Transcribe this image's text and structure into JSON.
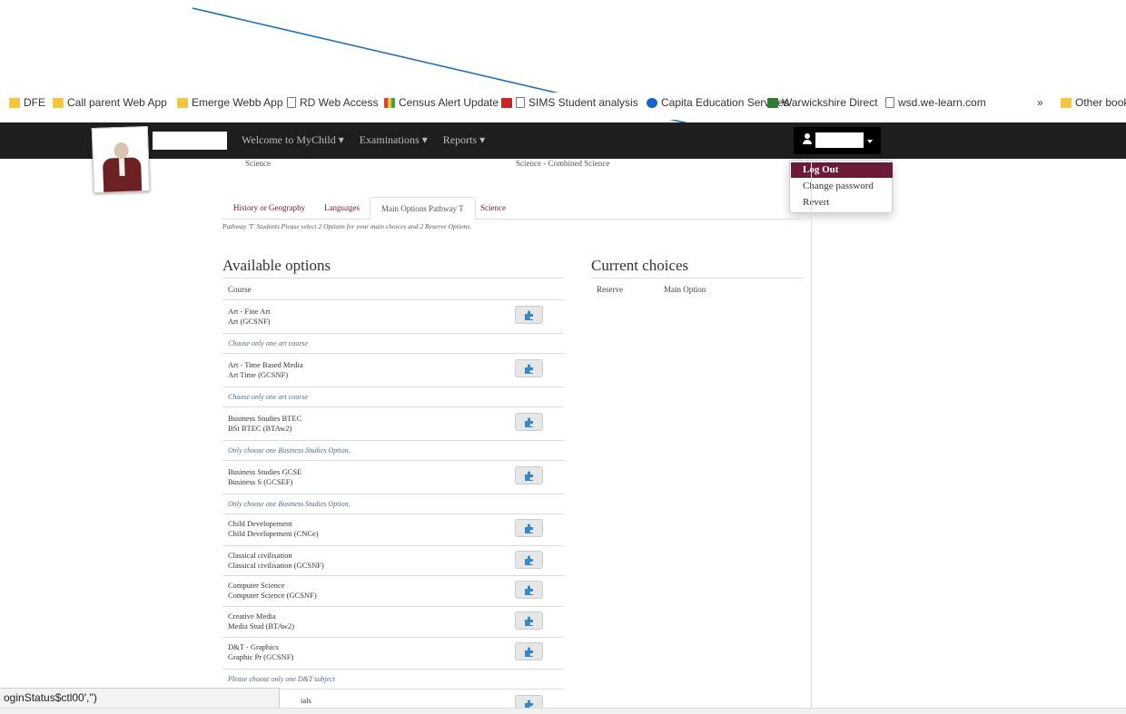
{
  "bookmarks": [
    {
      "label": "DFE",
      "icon": "folder-icon"
    },
    {
      "label": "Call parent Web App",
      "icon": "folder-icon"
    },
    {
      "label": "Emerge Webb App",
      "icon": "folder-icon"
    },
    {
      "label": "RD Web Access",
      "icon": "page-icon"
    },
    {
      "label": "Census Alert Update",
      "icon": "green-icon"
    },
    {
      "label": "SIMS Student analysis",
      "icon": "page-icon"
    },
    {
      "label": "Capita Education Services",
      "icon": "blue-icon"
    },
    {
      "label": "Warwickshire Direct",
      "icon": "page-icon"
    },
    {
      "label": "wsd.we-learn.com",
      "icon": "page-icon"
    },
    {
      "label": "»",
      "icon": ""
    },
    {
      "label": "Other bookmarks",
      "icon": "folder-icon"
    }
  ],
  "navbar": {
    "links": [
      "Welcome to MyChild ▾",
      "Examinations ▾",
      "Reports ▾"
    ],
    "user_menu": [
      "Log Out",
      "Change password",
      "Revert"
    ]
  },
  "subject": {
    "left": "Science",
    "right": "Science - Combined Science"
  },
  "tabs": [
    "History or Geography",
    "Languages",
    "Main Options Pathway T",
    "Science"
  ],
  "instructions": "Pathway 'T' Students Please select 2 Options for your main choices and 2 Reserve Options.",
  "available": {
    "title": "Available options",
    "column": "Course",
    "courses": [
      {
        "name": "Art - Fine Art",
        "code": "Art (GCSNF)",
        "note": "Choose only one art course"
      },
      {
        "name": "Art - Time Based Media",
        "code": "Art Time (GCSNF)",
        "note": "Choose only one art course"
      },
      {
        "name": "Business Studies BTEC",
        "code": "BSt BTEC (BTAw2)",
        "note": "Only choose one Business Studies Option."
      },
      {
        "name": "Business Studies GCSE",
        "code": "Business S (GCSEF)",
        "note": "Only choose one Business Studies Option."
      },
      {
        "name": "Child Developement",
        "code": "Child Developement (CNCe)",
        "note": ""
      },
      {
        "name": "Classical civilisation",
        "code": "Classical civilisation (GCSNF)",
        "note": ""
      },
      {
        "name": "Computer Science",
        "code": "Computer Science (GCSNF)",
        "note": ""
      },
      {
        "name": "Creative Media",
        "code": "Media Stud (BTAw2)",
        "note": ""
      },
      {
        "name": "D&T - Graphics",
        "code": "Graphic Pr (GCSNF)",
        "note": "Please choose only one D&T subject"
      }
    ],
    "partial": "ials"
  },
  "current": {
    "title": "Current choices",
    "columns": [
      "Reserve",
      "Main Option"
    ]
  },
  "statusbar": "oginStatus$ctl00','')",
  "colors": {
    "accent": "#6b1a3a",
    "navbar": "#1e1e1e",
    "arrow": "#1f6fb5"
  }
}
